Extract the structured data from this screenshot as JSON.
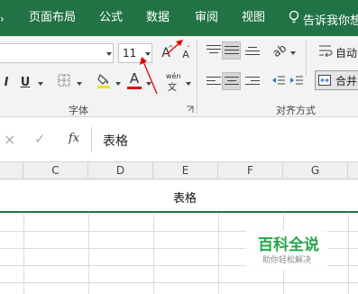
{
  "ribbon_tabs": [
    {
      "label": "页面布局"
    },
    {
      "label": "公式"
    },
    {
      "label": "数据"
    },
    {
      "label": "审阅"
    },
    {
      "label": "视图"
    },
    {
      "label": "告诉我你想"
    }
  ],
  "font": {
    "size_value": "11",
    "grow_label": "A",
    "shrink_label": "A",
    "italic_label": "I",
    "underline_label": "U",
    "fill_color_hex": "#f5e200",
    "font_color_label": "A",
    "font_color_hex": "#e00000",
    "phonetic_label": "wén",
    "group_label": "字体"
  },
  "alignment": {
    "wrap_label": "自动",
    "merge_label": "合并",
    "group_label": "对齐方式"
  },
  "formula_bar": {
    "cancel_icon": "×",
    "enter_icon": "✓",
    "fx_label": "fx",
    "content": "表格"
  },
  "columns": [
    "C",
    "D",
    "E",
    "F",
    "G"
  ],
  "cell": {
    "merged_value": "表格"
  },
  "watermark": {
    "title": "百科全说",
    "subtitle": "助你轻松解决"
  },
  "colors": {
    "excel_green": "#217346",
    "annotation_red": "#e00000"
  }
}
